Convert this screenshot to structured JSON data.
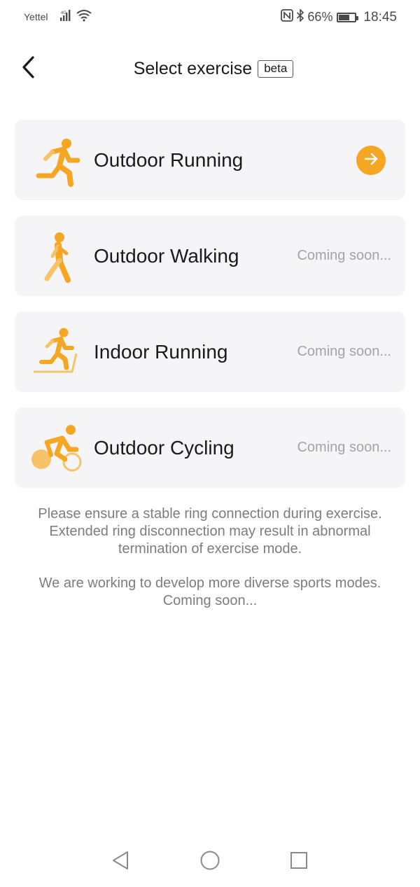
{
  "status_bar": {
    "carrier": "Yettel",
    "battery_percent_label": "66%",
    "battery_level": 0.66,
    "time": "18:45",
    "icons": [
      "signal-icon",
      "wifi-icon",
      "nfc-icon",
      "bluetooth-icon",
      "battery-icon"
    ]
  },
  "header": {
    "title": "Select exercise",
    "badge": "beta",
    "back_icon": "chevron-left-icon"
  },
  "exercises": [
    {
      "name": "Outdoor Running",
      "status": "",
      "icon": "outdoor-running-icon",
      "action_icon": "arrow-right-icon"
    },
    {
      "name": "Outdoor Walking",
      "status": "Coming soon...",
      "icon": "outdoor-walking-icon"
    },
    {
      "name": "Indoor Running",
      "status": "Coming soon...",
      "icon": "indoor-running-icon"
    },
    {
      "name": "Outdoor Cycling",
      "status": "Coming soon...",
      "icon": "outdoor-cycling-icon"
    }
  ],
  "notes": {
    "connection": "Please ensure a stable ring connection during exercise. Extended ring disconnection may result in abnormal termination of exercise mode.",
    "development": "We are working to develop more diverse sports modes. Coming soon..."
  },
  "nav_bar": {
    "icons": [
      "nav-back-icon",
      "nav-home-icon",
      "nav-recents-icon"
    ]
  },
  "colors": {
    "accent": "#f5a623",
    "card_background": "#f5f5f7",
    "muted_text": "#a3a3a8"
  }
}
